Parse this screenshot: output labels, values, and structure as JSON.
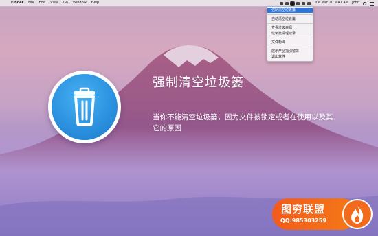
{
  "menubar": {
    "apple_glyph": "",
    "menus": [
      "Finder",
      "File",
      "Edit",
      "View",
      "Go",
      "Window",
      "Help"
    ],
    "clock": "Tue Mar 20  9:41 AM",
    "user": "John"
  },
  "dropdown": {
    "items": [
      {
        "label": "强制清空垃圾篓",
        "selected": true
      },
      {
        "label": "自动清空垃圾篓"
      },
      {
        "label": "查看垃圾来源"
      },
      {
        "label": "垃圾篓清理记录"
      },
      {
        "label": "文件粉碎"
      },
      {
        "label": "展示产品指引窗体"
      },
      {
        "label": "退出软件"
      }
    ]
  },
  "main": {
    "title": "强制清空垃圾篓",
    "description": "当你不能清空垃圾篓，因为文件被锁定或者在使用以及其它的原因"
  },
  "watermark": {
    "title": "图穷联盟",
    "qq": "QQ:985303259"
  },
  "colors": {
    "accent_blue": "#2a8fde",
    "watermark_orange": "#f25b1b",
    "selection_blue": "#2f74d6"
  },
  "icons": {
    "app": "trash-icon",
    "watermark_logo": "flame-icon"
  }
}
